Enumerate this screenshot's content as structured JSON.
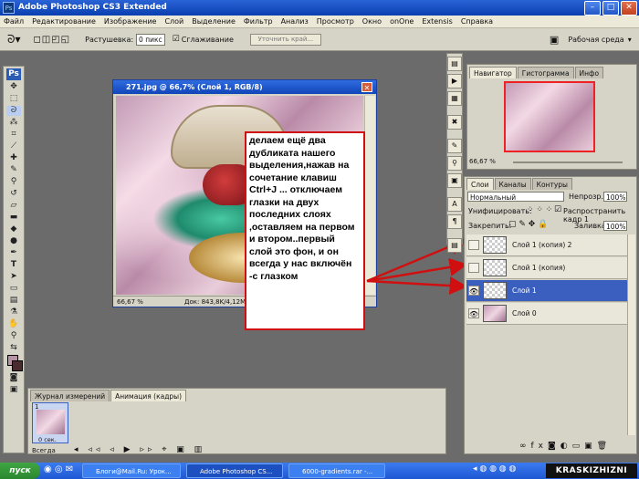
{
  "app": {
    "title": "Adobe Photoshop CS3 Extended",
    "ps_badge": "Ps"
  },
  "menu": [
    "Файл",
    "Редактирование",
    "Изображение",
    "Слой",
    "Выделение",
    "Фильтр",
    "Анализ",
    "Просмотр",
    "Окно",
    "onOne",
    "Extensis",
    "Справка"
  ],
  "options": {
    "feather_label": "Растушевка:",
    "feather_value": "0 пикс",
    "antialias_label": "Сглаживание",
    "refine_button": "Уточнить край...",
    "workspace_label": "Рабочая среда",
    "antialias_checked": true
  },
  "document": {
    "title": "271.jpg @ 66,7% (Слой 1, RGB/8)",
    "zoom": "66,67 %",
    "doc_size": "Док: 843,8K/4,12M"
  },
  "note": {
    "text": "делаем ещё два дубликата нашего выделения,нажав на сочетание клавиш  Ctrl+J ... отключаем глазки на двух последних слоях  ,оставляем на первом и втором..первый слой это фон, и он всегда у нас включён -с глазком",
    "border_color": "#d01010",
    "arrow_color": "#d01010"
  },
  "navigator": {
    "tabs": [
      "Навигатор",
      "Гистограмма",
      "Инфо"
    ],
    "zoom": "66,67 %"
  },
  "layers": {
    "tabs": [
      "Слои",
      "Каналы",
      "Контуры"
    ],
    "blend_mode": "Нормальный",
    "opacity_label": "Непрозр.:",
    "opacity_value": "100%",
    "unify_label": "Унифицировать:",
    "propagate_label": "Распространить кадр 1",
    "lock_label": "Закрепить:",
    "fill_label": "Заливка:",
    "fill_value": "100%",
    "rows": [
      {
        "name": "Слой 1 (копия) 2",
        "visible": false,
        "selected": false
      },
      {
        "name": "Слой 1 (копия)",
        "visible": false,
        "selected": false
      },
      {
        "name": "Слой 1",
        "visible": true,
        "selected": true
      },
      {
        "name": "Слой 0",
        "visible": true,
        "selected": false
      }
    ],
    "footer_icons": [
      "link-icon",
      "fx-icon",
      "mask-icon",
      "adjustment-icon",
      "group-icon",
      "new-layer-icon",
      "trash-icon"
    ]
  },
  "animation": {
    "tabs": [
      "Журнал измерений",
      "Анимация (кадры)"
    ],
    "frame_number": "1",
    "frame_time": "0 сек.",
    "loop": "Всегда"
  },
  "taskbar": {
    "start": "пуск",
    "tasks": [
      "Блоги@Mail.Ru: Урок...",
      "Adobe Photoshop CS...",
      "6000-gradients.rar -..."
    ],
    "clock": ""
  },
  "watermark": "KRASKIZHIZNI"
}
